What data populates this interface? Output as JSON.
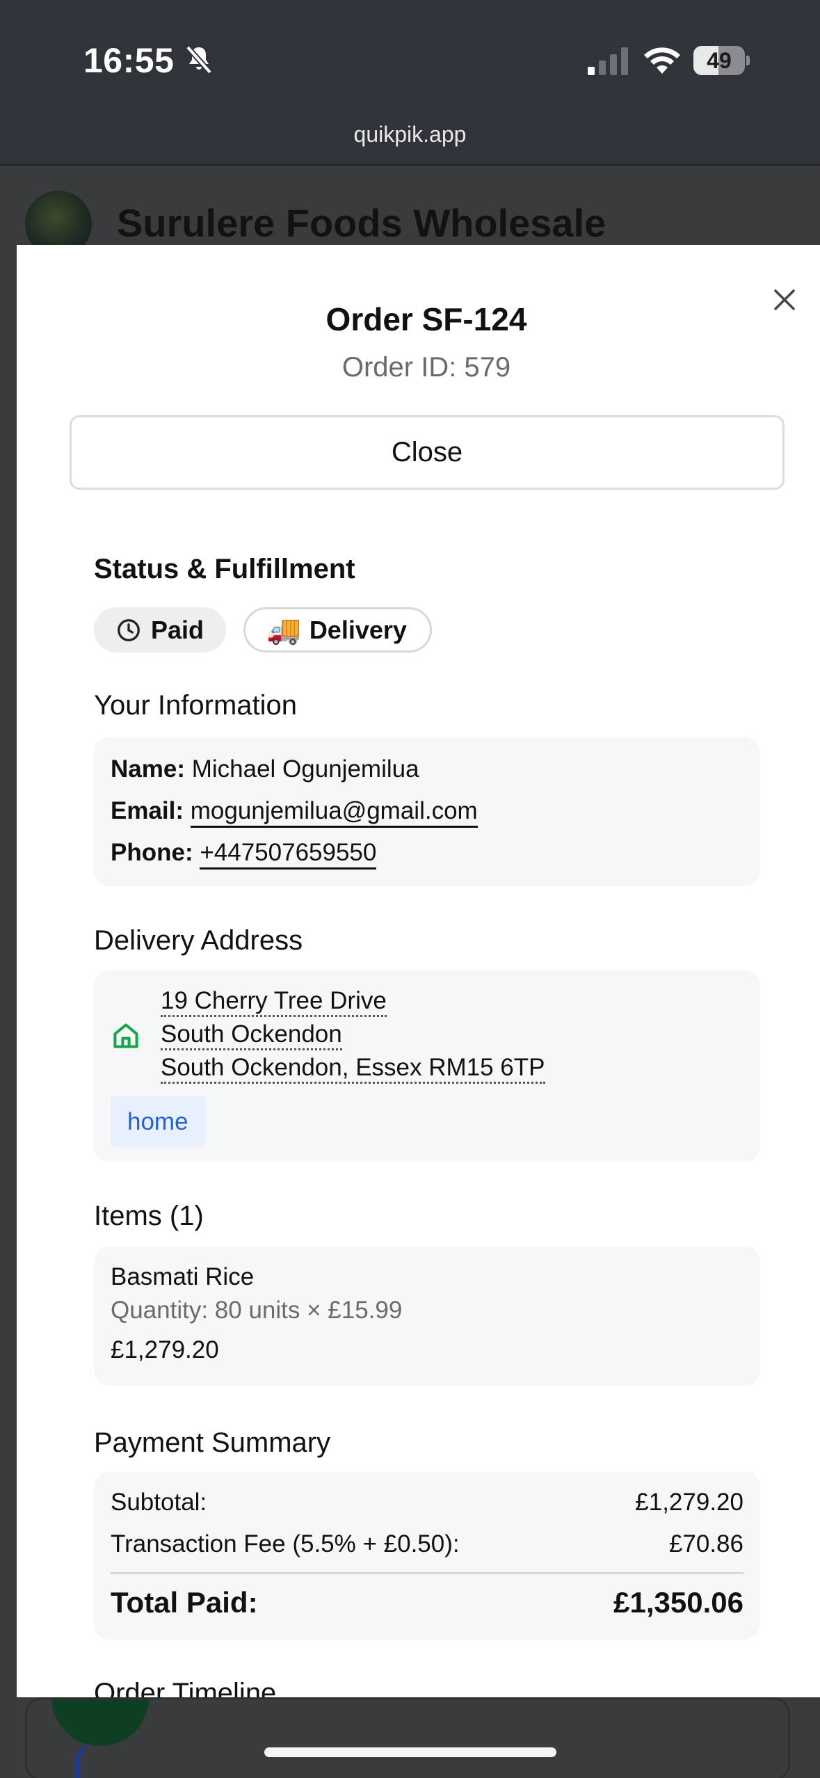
{
  "status_bar": {
    "time": "16:55",
    "battery": "49",
    "battery_level": 0.49,
    "url": "quikpik.app"
  },
  "background": {
    "store_name": "Surulere Foods Wholesale"
  },
  "modal": {
    "title": "Order SF-124",
    "order_id": "Order ID: 579",
    "close_label": "Close",
    "status_section": {
      "heading": "Status & Fulfillment",
      "paid_label": "Paid",
      "delivery_label": "Delivery",
      "delivery_emoji": "🚚"
    },
    "info_section": {
      "heading": "Your Information",
      "name_label": "Name:",
      "name": "Michael Ogunjemilua",
      "email_label": "Email:",
      "email": "mogunjemilua@gmail.com",
      "phone_label": "Phone:",
      "phone": "+447507659550"
    },
    "address_section": {
      "heading": "Delivery Address",
      "line1": "19 Cherry Tree Drive",
      "line2": "South Ockendon",
      "line3": "South Ockendon, Essex RM15 6TP",
      "tag": "home"
    },
    "items_section": {
      "heading": "Items (1)",
      "items": [
        {
          "name": "Basmati Rice",
          "quantity": "Quantity: 80 units × £15.99",
          "price": "£1,279.20"
        }
      ]
    },
    "payment_section": {
      "heading": "Payment Summary",
      "subtotal_label": "Subtotal:",
      "subtotal": "£1,279.20",
      "fee_label": "Transaction Fee (5.5% + £0.50):",
      "fee": "£70.86",
      "total_label": "Total Paid:",
      "total": "£1,350.06"
    },
    "timeline_section": {
      "heading": "Order Timeline"
    }
  },
  "colors": {
    "status_bar_bg": "#303339",
    "modal_bg": "#ffffff",
    "card_bg": "#f6f7f9",
    "home_icon": "#16a34a",
    "tag_text": "#2563c9",
    "tag_bg": "#e8f0fe"
  }
}
